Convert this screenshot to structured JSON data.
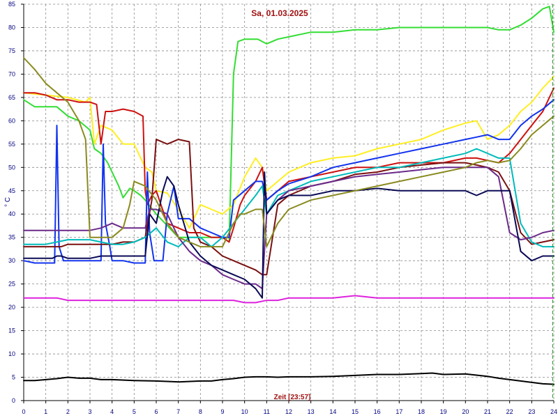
{
  "chart_data": {
    "type": "line",
    "title": "Sa, 01.03.2025",
    "xlabel": "Zeit [23:57]",
    "ylabel": "° C",
    "xlim": [
      0,
      24
    ],
    "ylim": [
      0,
      85
    ],
    "x_ticks": [
      0,
      1,
      2,
      3,
      4,
      5,
      6,
      7,
      8,
      9,
      10,
      11,
      12,
      13,
      14,
      15,
      16,
      17,
      18,
      19,
      20,
      21,
      22,
      23,
      24
    ],
    "y_ticks": [
      0,
      5,
      10,
      15,
      20,
      25,
      30,
      35,
      40,
      45,
      50,
      55,
      60,
      65,
      70,
      75,
      80,
      85
    ],
    "grid": true,
    "current_time_marker": 23.95,
    "series": [
      {
        "color": "#33dd33",
        "x": [
          0,
          0.5,
          1,
          1.5,
          2,
          2.5,
          3,
          3.2,
          3.5,
          3.8,
          4,
          4.3,
          4.5,
          4.8,
          5,
          5.3,
          5.5,
          6,
          7,
          8,
          9,
          9.3,
          9.5,
          9.7,
          10,
          10.3,
          10.6,
          10.8,
          11,
          11.5,
          12,
          13,
          14,
          15,
          16,
          17,
          18,
          19,
          20,
          21,
          21.5,
          22,
          22.5,
          23,
          23.5,
          23.8,
          24
        ],
        "y": [
          64.5,
          63,
          63,
          63,
          61,
          60,
          58,
          54,
          53,
          51,
          49,
          46,
          43.5,
          45.5,
          45,
          44,
          43,
          40,
          35,
          35,
          35,
          34,
          70,
          77,
          77.5,
          77.5,
          77.5,
          77,
          76.5,
          77.5,
          78,
          79,
          79,
          79.5,
          79.5,
          80,
          80,
          80,
          80,
          80,
          79.5,
          79.5,
          80.5,
          82,
          84,
          84.5,
          79
        ]
      },
      {
        "color": "#ffee22",
        "x": [
          0,
          1,
          2,
          2.8,
          3,
          3.2,
          3.5,
          4,
          4.5,
          5,
          5.5,
          5.8,
          6,
          6.5,
          7,
          7.5,
          8,
          8.5,
          9,
          9.5,
          10,
          10.5,
          10.8,
          11,
          11.5,
          12,
          13,
          14,
          15,
          16,
          17,
          18,
          19,
          20,
          20.5,
          21,
          21.5,
          22,
          22.5,
          23,
          23.5,
          24
        ],
        "y": [
          66,
          65.5,
          65,
          64,
          65,
          55,
          59,
          58,
          55,
          55,
          50,
          49,
          45,
          44.5,
          41,
          37,
          42,
          41,
          40,
          42,
          48,
          52,
          50,
          45,
          47,
          49,
          51,
          52,
          52.5,
          54,
          55,
          56,
          58,
          59.5,
          60,
          56,
          57,
          59,
          62,
          64,
          67,
          69.5
        ]
      },
      {
        "color": "#cc1111",
        "x": [
          0,
          0.5,
          1,
          1.5,
          2,
          2.5,
          3,
          3.3,
          3.5,
          3.7,
          4,
          4.5,
          5,
          5.4,
          5.5,
          5.6,
          5.8,
          6,
          6.5,
          7,
          7.5,
          8,
          8.5,
          9,
          9.3,
          9.5,
          9.8,
          10,
          10.5,
          10.8,
          11,
          11.5,
          12,
          13,
          14,
          15,
          16,
          17,
          18,
          19,
          20,
          20.5,
          21,
          21.5,
          22,
          22.5,
          23,
          23.5,
          24
        ],
        "y": [
          66,
          66,
          65.5,
          64.5,
          64.5,
          64,
          64,
          63.5,
          55,
          62,
          62,
          62.5,
          62,
          61,
          45,
          42,
          44,
          45,
          38,
          37,
          36,
          36,
          35,
          35,
          34,
          37,
          42,
          44,
          47,
          50,
          43,
          45,
          47,
          48,
          49,
          50,
          50,
          51,
          51,
          51,
          52,
          52,
          51.5,
          51,
          53,
          56,
          59,
          62,
          67
        ]
      },
      {
        "color": "#1133ee",
        "x": [
          0,
          0.5,
          1,
          1.2,
          1.4,
          1.5,
          1.6,
          1.8,
          2,
          2.5,
          3,
          3.3,
          3.5,
          3.6,
          3.7,
          3.9,
          4,
          4.5,
          5,
          5.3,
          5.5,
          5.6,
          5.7,
          5.9,
          6,
          6.3,
          6.5,
          6.8,
          7,
          7.5,
          8,
          8.5,
          9,
          9.3,
          9.5,
          10,
          10.5,
          10.8,
          11,
          11.5,
          12,
          13,
          14,
          15,
          16,
          17,
          18,
          19,
          20,
          20.5,
          21,
          21.5,
          22,
          22.5,
          23,
          23.5,
          24
        ],
        "y": [
          30,
          29.5,
          29.5,
          29.5,
          29.5,
          59,
          33,
          30,
          30,
          30,
          30,
          30,
          30,
          55,
          38,
          33,
          30,
          30,
          29.5,
          29.5,
          29.5,
          49,
          36,
          30,
          30,
          30,
          40,
          46,
          39,
          39,
          37,
          36,
          35,
          35,
          43,
          45,
          47,
          47,
          43,
          45,
          46.5,
          48,
          50,
          51,
          52,
          53,
          54,
          55,
          56,
          56.5,
          57,
          56,
          56,
          59,
          61,
          62.5,
          64.5
        ]
      },
      {
        "color": "#7a1010",
        "x": [
          0,
          0.5,
          1,
          1.3,
          1.5,
          1.7,
          2,
          2.5,
          3,
          3.5,
          4,
          4.5,
          5,
          5.5,
          5.8,
          6,
          6.5,
          7,
          7.5,
          7.7,
          8,
          8.5,
          9,
          9.5,
          10,
          10.5,
          10.8,
          11,
          11.5,
          12,
          13,
          14,
          15,
          16,
          17,
          18,
          19,
          20,
          20.5,
          21,
          21.5,
          22,
          22.5,
          23,
          23.5,
          24
        ],
        "y": [
          33,
          33,
          33,
          33,
          33,
          33,
          33.5,
          33.5,
          33.5,
          33.5,
          33.5,
          34,
          34,
          35,
          43,
          56,
          55,
          56,
          55.5,
          37,
          34,
          33,
          31,
          30,
          29,
          28,
          27,
          27,
          42,
          44,
          46,
          47,
          48.5,
          49,
          50,
          50.5,
          51,
          51,
          50.5,
          50,
          49,
          45,
          36,
          33.5,
          34,
          34.5
        ]
      },
      {
        "color": "#00bbbb",
        "x": [
          0,
          0.5,
          1,
          1.5,
          2,
          2.5,
          3,
          3.5,
          4,
          4.5,
          5,
          5.5,
          6,
          6.5,
          7,
          7.5,
          8,
          8.5,
          9,
          9.5,
          10,
          10.5,
          10.8,
          11,
          11.5,
          12,
          13,
          14,
          15,
          16,
          17,
          18,
          19,
          20,
          20.5,
          21,
          21.5,
          22,
          22.5,
          23,
          23.5,
          24
        ],
        "y": [
          33.5,
          33.5,
          33.5,
          34,
          34.5,
          34.5,
          34.5,
          34,
          33.5,
          33.5,
          34,
          35,
          37,
          34,
          33,
          35,
          35,
          33,
          35,
          38,
          41,
          44,
          46,
          40,
          44,
          45,
          47,
          48,
          49,
          50,
          50,
          51,
          52,
          53,
          54,
          53,
          52,
          52,
          38,
          34,
          33,
          33
        ]
      },
      {
        "color": "#6b2a8a",
        "x": [
          0,
          0.5,
          1,
          1.5,
          2,
          2.5,
          3,
          3.5,
          4,
          4.5,
          5,
          5.5,
          5.7,
          6,
          6.5,
          7,
          7.5,
          8,
          8.5,
          9,
          9.5,
          10,
          10.5,
          10.8,
          11,
          11.5,
          12,
          13,
          14,
          15,
          16,
          17,
          18,
          19,
          20,
          20.5,
          21,
          21.5,
          22,
          22.5,
          23,
          23.5,
          24
        ],
        "y": [
          36.5,
          36.5,
          36.5,
          36.5,
          36.5,
          36.5,
          36.5,
          37,
          38,
          37,
          37,
          37,
          41,
          41,
          40,
          35,
          32,
          30,
          29,
          27,
          26,
          25,
          25,
          24,
          40,
          43,
          45,
          46,
          47,
          48,
          48.5,
          49,
          49.5,
          50,
          50,
          50,
          50,
          48,
          36,
          34.5,
          35,
          36,
          36.5
        ]
      },
      {
        "color": "#0a0a55",
        "x": [
          0,
          0.5,
          1,
          1.3,
          1.5,
          1.7,
          2,
          2.5,
          3,
          3.5,
          4,
          4.5,
          5,
          5.5,
          5.7,
          6,
          6.3,
          6.5,
          6.8,
          7,
          7.5,
          8,
          8.5,
          9,
          9.5,
          10,
          10.5,
          10.8,
          10.9,
          11,
          11.5,
          12,
          13,
          14,
          15,
          16,
          17,
          18,
          19,
          20,
          20.5,
          21,
          21.5,
          22,
          22.5,
          23,
          23.5,
          24
        ],
        "y": [
          30.5,
          30.5,
          30.5,
          30.5,
          31,
          31,
          30.5,
          30.5,
          30.5,
          31,
          31,
          31,
          31,
          31,
          40,
          38,
          45,
          48,
          46,
          42,
          34,
          31,
          29,
          28,
          27,
          26,
          24,
          22,
          49,
          40,
          43,
          44,
          44,
          45,
          45,
          45.5,
          45,
          45,
          45,
          45,
          44,
          45,
          45,
          45,
          32,
          30,
          31,
          31
        ]
      },
      {
        "color": "#8a8a20",
        "x": [
          0,
          0.5,
          1,
          1.5,
          2,
          2.5,
          2.8,
          3,
          3.5,
          4,
          4.5,
          4.8,
          5,
          5.5,
          6,
          6.5,
          7,
          7.5,
          8,
          8.5,
          9,
          9.5,
          9.8,
          10,
          10.5,
          10.8,
          11,
          11.5,
          12,
          13,
          14,
          15,
          16,
          17,
          18,
          19,
          20,
          20.5,
          21,
          21.5,
          22,
          22.5,
          23,
          23.5,
          24
        ],
        "y": [
          73.5,
          71,
          68,
          66,
          64,
          60,
          56,
          35,
          35,
          35,
          37,
          42,
          47,
          46,
          43,
          38,
          35,
          34,
          33,
          33,
          33,
          38,
          40,
          40,
          41,
          41,
          33,
          38,
          41,
          43,
          44,
          45,
          46,
          47,
          48,
          49,
          50,
          51,
          51.5,
          51,
          51.5,
          54,
          57,
          59,
          61
        ]
      },
      {
        "color": "#dd22dd",
        "x": [
          0,
          0.5,
          1,
          1.5,
          2,
          3,
          4,
          5,
          6,
          7,
          8,
          9,
          9.5,
          10,
          10.5,
          11,
          11.5,
          12,
          13,
          14,
          15,
          16,
          17,
          18,
          19,
          20,
          21,
          22,
          23,
          24
        ],
        "y": [
          22,
          22,
          22,
          22,
          21.5,
          21.5,
          21.5,
          21.5,
          21.5,
          21.5,
          21.5,
          21.5,
          21.5,
          21,
          21,
          21.5,
          21.5,
          22,
          22,
          22,
          22.5,
          22,
          22,
          22,
          22,
          22,
          22,
          22,
          22,
          22
        ]
      },
      {
        "color": "#000000",
        "x": [
          0,
          0.5,
          1,
          1.5,
          2,
          2.5,
          3,
          3.5,
          4,
          5,
          6,
          7,
          8,
          8.5,
          9,
          9.5,
          10,
          10.5,
          11,
          11.5,
          12,
          13,
          14,
          15,
          16,
          17,
          18,
          18.5,
          19,
          20,
          21,
          21.5,
          22,
          22.5,
          23,
          23.5,
          24
        ],
        "y": [
          4.3,
          4.3,
          4.5,
          4.7,
          5,
          4.8,
          4.8,
          4.5,
          4.5,
          4.3,
          4.2,
          4,
          4.2,
          4.2,
          4.5,
          4.7,
          5,
          5.1,
          5.1,
          5,
          5.1,
          5.1,
          5.2,
          5.4,
          5.6,
          5.6,
          5.8,
          5.9,
          5.6,
          5.7,
          5.2,
          4.8,
          4.5,
          4.2,
          3.9,
          3.6,
          3.5
        ]
      }
    ]
  }
}
